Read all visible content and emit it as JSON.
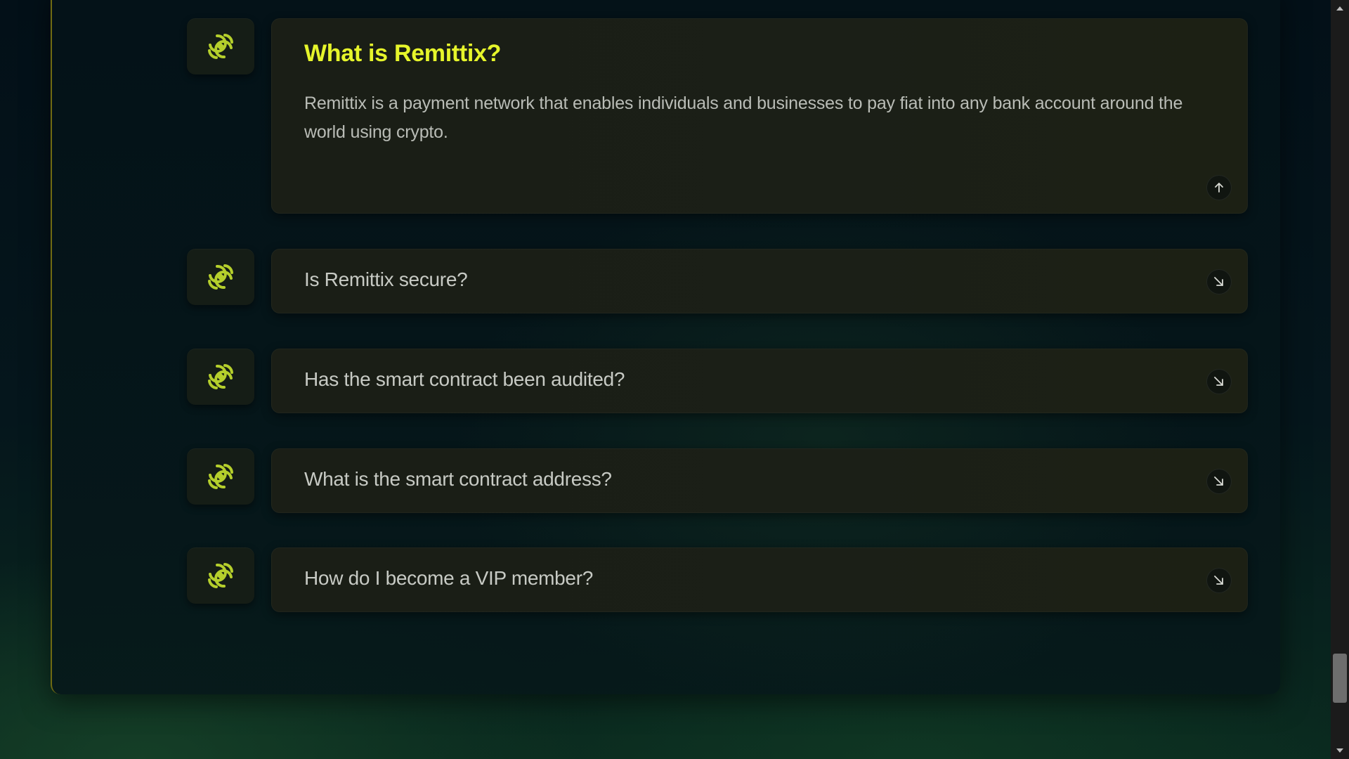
{
  "faq": {
    "items": [
      {
        "question": "What is Remittix?",
        "answer": "Remittix is a payment network that enables individuals and businesses to pay fiat into any bank account around the world using crypto.",
        "expanded": true,
        "toggle_icon": "arrow-up-icon"
      },
      {
        "question": "Is Remittix secure?",
        "expanded": false,
        "toggle_icon": "arrow-down-right-icon"
      },
      {
        "question": "Has the smart contract been audited?",
        "expanded": false,
        "toggle_icon": "arrow-down-right-icon"
      },
      {
        "question": "What is the smart contract address?",
        "expanded": false,
        "toggle_icon": "arrow-down-right-icon"
      },
      {
        "question": "How do I become a VIP member?",
        "expanded": false,
        "toggle_icon": "arrow-down-right-icon"
      }
    ],
    "item_icon": "remittix-logo-icon"
  },
  "colors": {
    "accent": "#e6f52b",
    "icon_green": "#b5cf2c",
    "card_bg": "#1b1f17",
    "question_text": "#c7cac4",
    "answer_text": "#b9bcb6",
    "page_bg": "#04121a"
  },
  "scrollbar": {
    "position_fraction": 0.92
  }
}
